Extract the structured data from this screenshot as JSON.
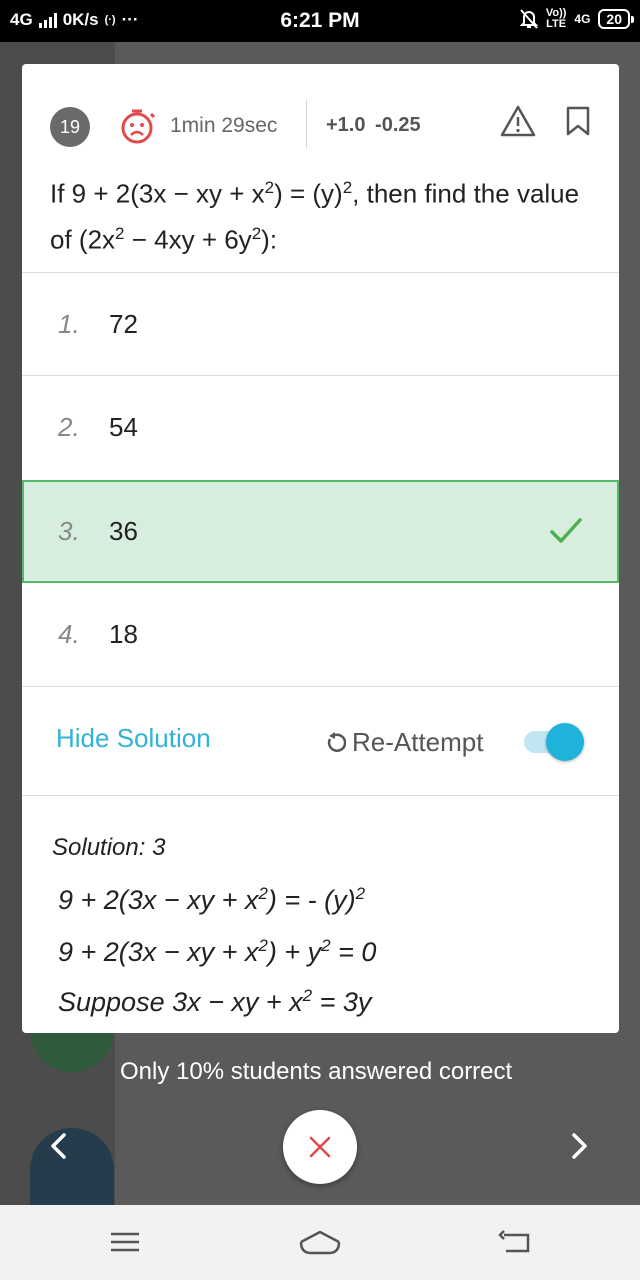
{
  "status_bar": {
    "network": "4G",
    "speed": "0K/s",
    "hotspot": "(·)",
    "more": "···",
    "time": "6:21 PM",
    "volte": "Vo))",
    "lte_label": "LTE",
    "network_right": "4G",
    "battery": "20"
  },
  "question": {
    "number": "19",
    "time_taken": "1min 29sec",
    "marks_positive": "+1.0",
    "marks_negative": "-0.25",
    "text_a": "If 9 + 2(3x − xy + x",
    "text_b": ") = (y)",
    "text_c": ", then find the value of (2x",
    "text_d": " − 4xy + 6y",
    "text_e": "):",
    "sup": "2"
  },
  "options": [
    {
      "num": "1.",
      "value": "72",
      "correct": false
    },
    {
      "num": "2.",
      "value": "54",
      "correct": false
    },
    {
      "num": "3.",
      "value": "36",
      "correct": true
    },
    {
      "num": "4.",
      "value": "18",
      "correct": false
    }
  ],
  "actions": {
    "hide_solution": "Hide Solution",
    "reattempt": "Re-Attempt",
    "toggle_on": true
  },
  "solution": {
    "title": "Solution: 3",
    "line1_a": "9 + 2(3x − xy + x",
    "line1_b": ") = - (y)",
    "line2_a": "9 + 2(3x − xy + x",
    "line2_b": ") + y",
    "line2_c": " = 0",
    "line3_a": "Suppose 3x − xy + x",
    "line3_b": " = 3y",
    "sup": "2"
  },
  "footer": {
    "stat": "Only 10% students answered correct"
  },
  "colors": {
    "correct_bg": "#d7eddd",
    "correct_border": "#53b868",
    "accent": "#31b3d6",
    "toggle": "#1fb2db"
  }
}
